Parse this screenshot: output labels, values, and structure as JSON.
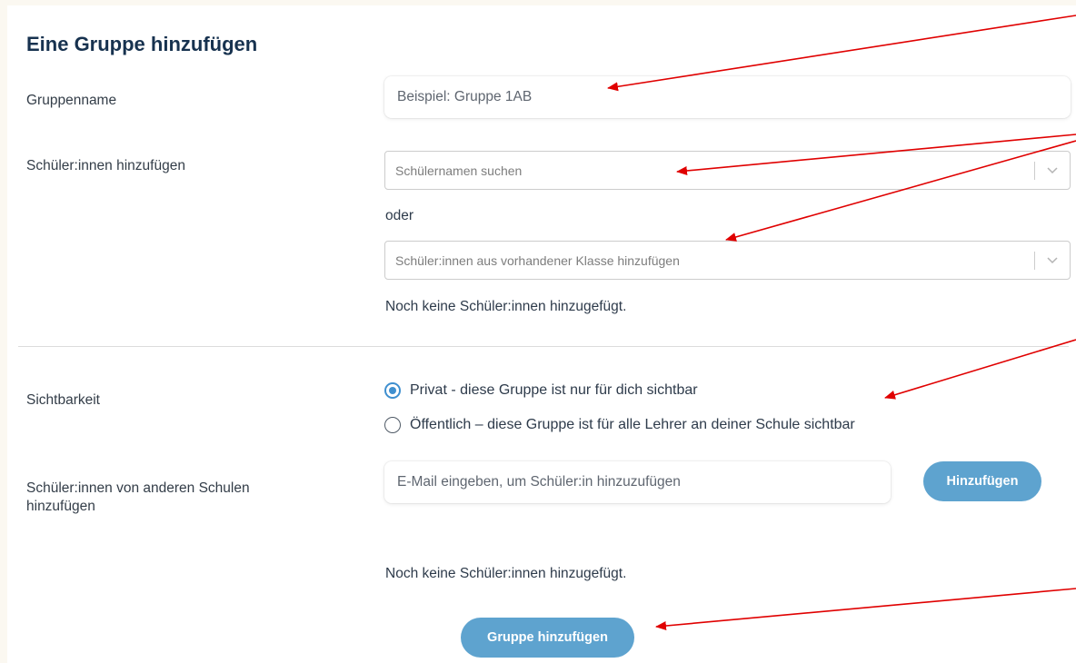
{
  "title": "Eine Gruppe hinzufügen",
  "group_name": {
    "label": "Gruppenname",
    "placeholder": "Beispiel: Gruppe 1AB"
  },
  "students": {
    "label": "Schüler:innen hinzufügen",
    "search_placeholder": "Schülernamen suchen",
    "or_text": "oder",
    "class_placeholder": "Schüler:innen aus vorhandener Klasse hinzufügen",
    "empty_text": "Noch keine Schüler:innen hinzugefügt."
  },
  "visibility": {
    "label": "Sichtbarkeit",
    "options": [
      {
        "label": "Privat - diese Gruppe ist nur für dich sichtbar",
        "checked": true
      },
      {
        "label": "Öffentlich – diese Gruppe ist für alle Lehrer an deiner Schule sichtbar",
        "checked": false
      }
    ]
  },
  "other_schools": {
    "label_line1": "Schüler:innen von anderen Schulen",
    "label_line2": "hinzufügen",
    "email_placeholder": "E-Mail eingeben, um Schüler:in hinzuzufügen",
    "add_button": "Hinzufügen",
    "empty_text": "Noch keine Schüler:innen hinzugefügt."
  },
  "submit_button": "Gruppe hinzufügen",
  "colors": {
    "accent": "#5ea3cf",
    "title": "#17324f",
    "annotation_arrow": "#e00000"
  }
}
